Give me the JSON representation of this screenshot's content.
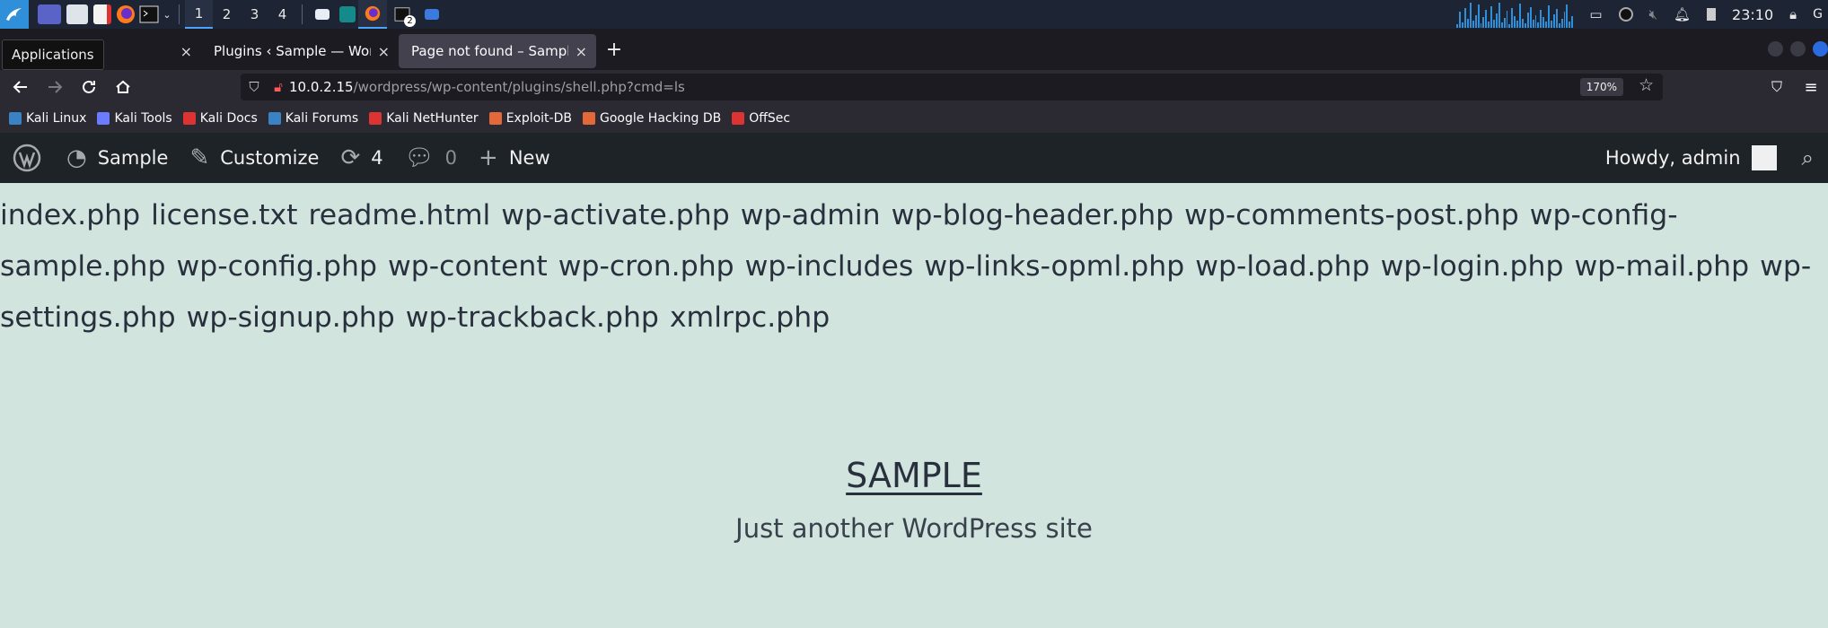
{
  "panel": {
    "workspaces": [
      "1",
      "2",
      "3",
      "4"
    ],
    "terminal_badge": "2",
    "clock": "23:10",
    "accent": "#2f8fd8"
  },
  "tooltip": "Applications",
  "tabs": [
    {
      "label": "",
      "close": "×"
    },
    {
      "label": "Plugins ‹ Sample — WordPress",
      "close": "×"
    },
    {
      "label": "Page not found – Sample",
      "close": "×"
    }
  ],
  "new_tab": "+",
  "url": {
    "host": "10.0.2.15",
    "path": "/wordpress/wp-content/plugins/shell.php?cmd=ls"
  },
  "zoom": "170%",
  "bookmarks": [
    {
      "label": "Kali Linux",
      "color": "#3b82c4"
    },
    {
      "label": "Kali Tools",
      "color": "#6b7cff"
    },
    {
      "label": "Kali Docs",
      "color": "#d33"
    },
    {
      "label": "Kali Forums",
      "color": "#3b82c4"
    },
    {
      "label": "Kali NetHunter",
      "color": "#d33"
    },
    {
      "label": "Exploit-DB",
      "color": "#e5683a"
    },
    {
      "label": "Google Hacking DB",
      "color": "#e5683a"
    },
    {
      "label": "OffSec",
      "color": "#d33"
    }
  ],
  "wpbar": {
    "site": "Sample",
    "customize": "Customize",
    "updates": "4",
    "comments": "0",
    "new": "New",
    "howdy": "Howdy, admin"
  },
  "listing": "index.php license.txt readme.html wp-activate.php wp-admin wp-blog-header.php wp-comments-post.php wp-config-sample.php wp-config.php wp-content wp-cron.php wp-includes wp-links-opml.php wp-load.php wp-login.php wp-mail.php wp-settings.php wp-signup.php wp-trackback.php xmlrpc.php",
  "site_title": "SAMPLE",
  "tagline": "Just another WordPress site"
}
